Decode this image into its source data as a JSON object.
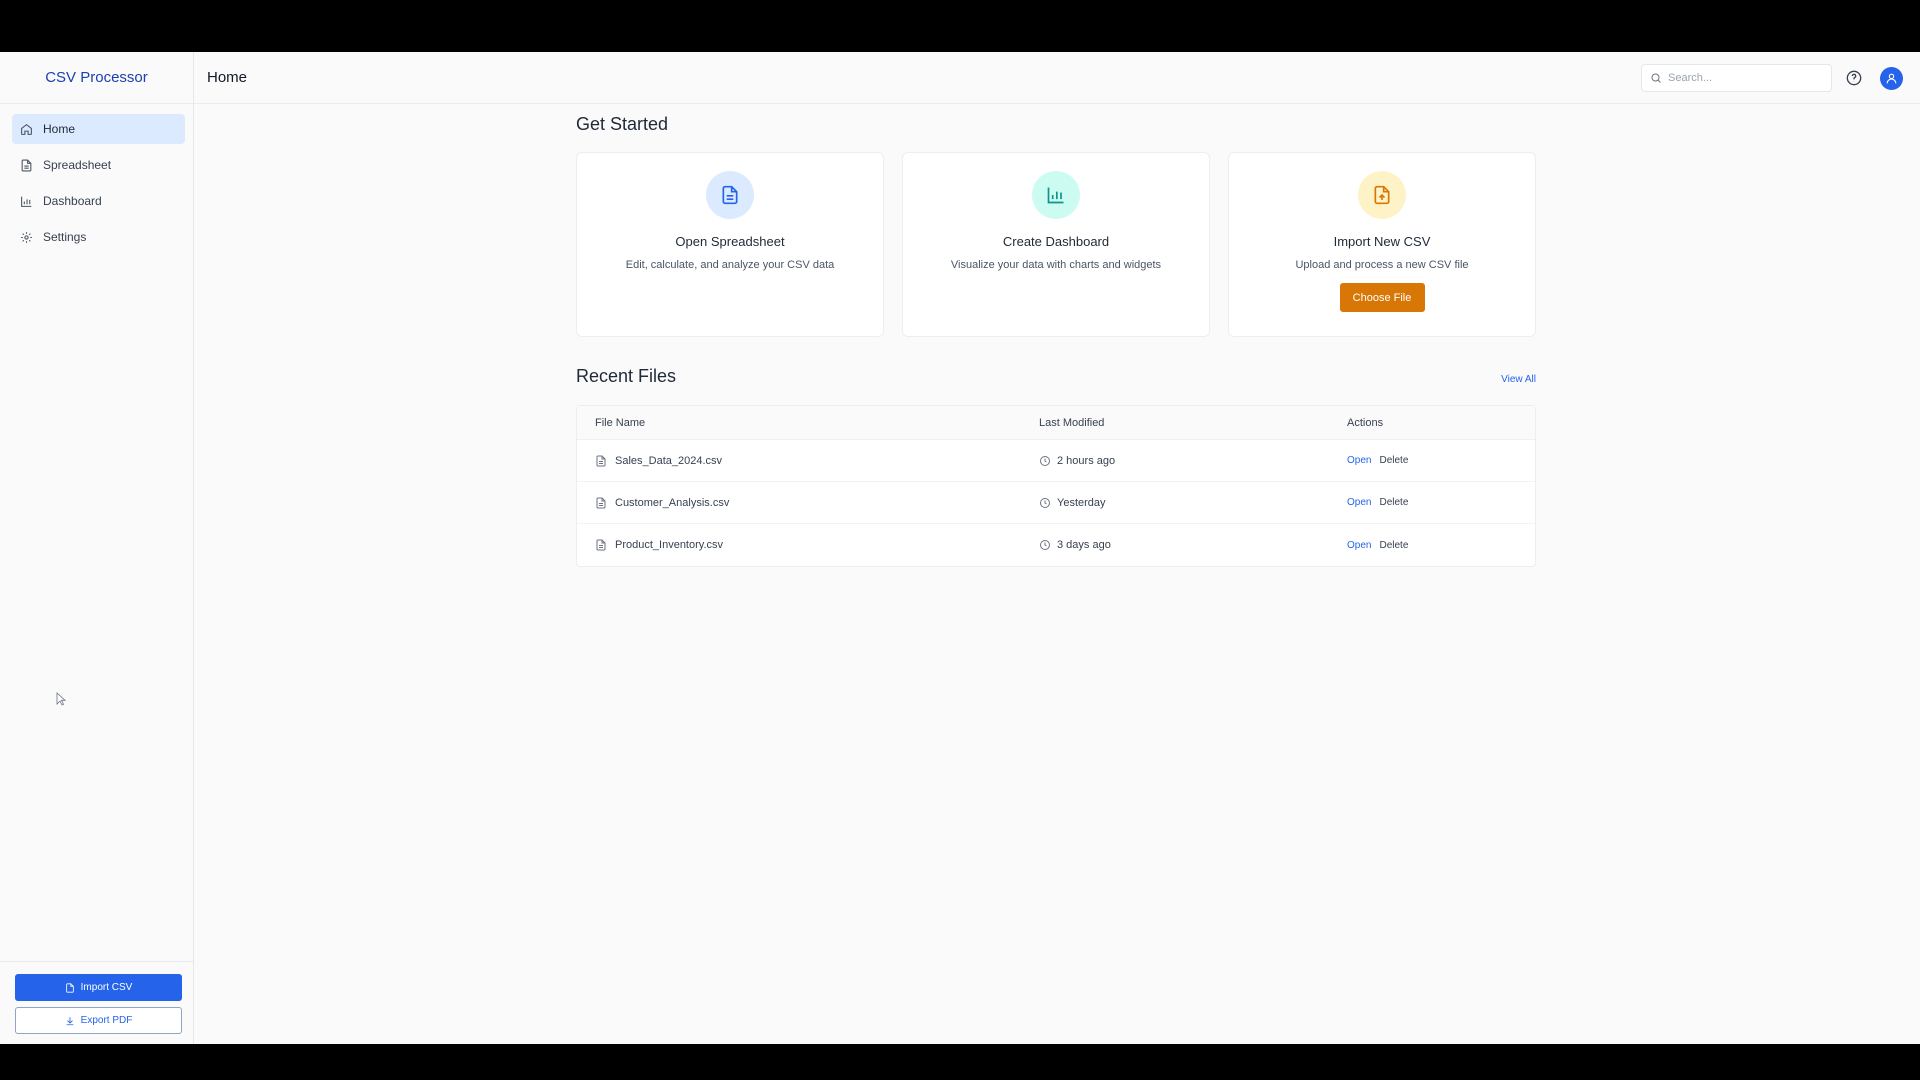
{
  "app": {
    "title": "CSV Processor"
  },
  "sidebar": {
    "items": [
      {
        "label": "Home",
        "icon": "home-icon",
        "active": true
      },
      {
        "label": "Spreadsheet",
        "icon": "file-icon",
        "active": false
      },
      {
        "label": "Dashboard",
        "icon": "bar-chart-icon",
        "active": false
      },
      {
        "label": "Settings",
        "icon": "gear-icon",
        "active": false
      }
    ],
    "import_label": "Import CSV",
    "export_label": "Export PDF"
  },
  "header": {
    "title": "Home",
    "search_placeholder": "Search..."
  },
  "get_started": {
    "title": "Get Started",
    "cards": [
      {
        "title": "Open Spreadsheet",
        "desc": "Edit, calculate, and analyze your CSV data",
        "icon": "spreadsheet-icon",
        "color": "#2563eb",
        "bg": "#dbeafe"
      },
      {
        "title": "Create Dashboard",
        "desc": "Visualize your data with charts and widgets",
        "icon": "chart-icon",
        "color": "#0d9488",
        "bg": "#ccfbf1"
      },
      {
        "title": "Import New CSV",
        "desc": "Upload and process a new CSV file",
        "icon": "file-upload-icon",
        "color": "#d97706",
        "bg": "#fef3c7",
        "button": "Choose File"
      }
    ]
  },
  "recent": {
    "title": "Recent Files",
    "view_all": "View All",
    "columns": [
      "File Name",
      "Last Modified",
      "Actions"
    ],
    "rows": [
      {
        "name": "Sales_Data_2024.csv",
        "modified": "2 hours ago",
        "open": "Open",
        "delete": "Delete"
      },
      {
        "name": "Customer_Analysis.csv",
        "modified": "Yesterday",
        "open": "Open",
        "delete": "Delete"
      },
      {
        "name": "Product_Inventory.csv",
        "modified": "3 days ago",
        "open": "Open",
        "delete": "Delete"
      }
    ]
  }
}
